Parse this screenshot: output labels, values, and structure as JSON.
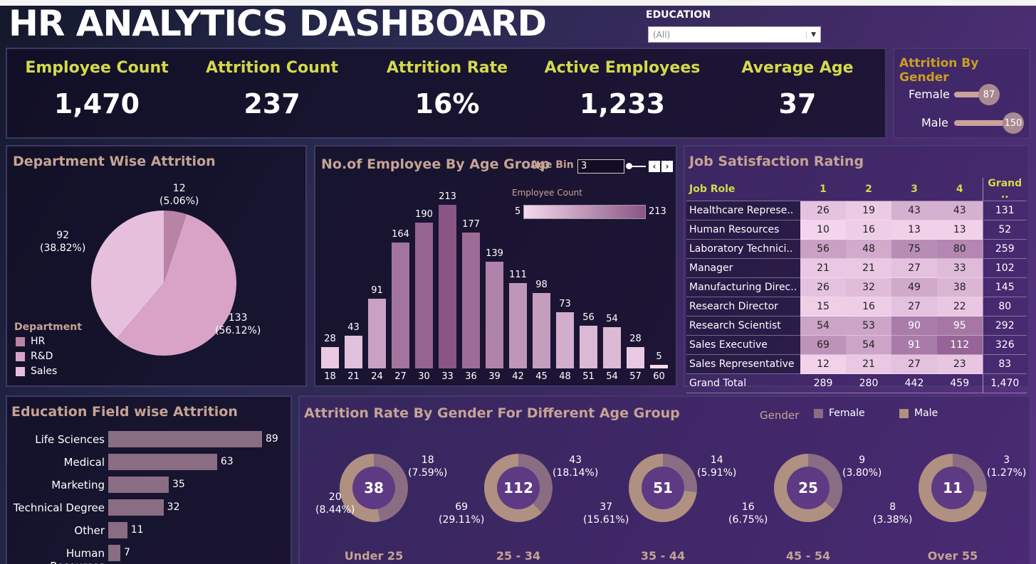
{
  "title": "HR ANALYTICS DASHBOARD",
  "filter": {
    "label": "EDUCATION",
    "value": "(All)"
  },
  "kpis": [
    {
      "label": "Employee Count",
      "value": "1,470"
    },
    {
      "label": "Attrition Count",
      "value": "237"
    },
    {
      "label": "Attrition Rate",
      "value": "16%"
    },
    {
      "label": "Active Employees",
      "value": "1,233"
    },
    {
      "label": "Average Age",
      "value": "37"
    }
  ],
  "gender_attrition": {
    "title": "Attrition By Gender",
    "items": [
      {
        "label": "Female",
        "value": "87",
        "fraction": 0.58
      },
      {
        "label": "Male",
        "value": "150",
        "fraction": 1.0
      }
    ]
  },
  "dept": {
    "title": "Department Wise Attrition",
    "legend_title": "Department",
    "legend": [
      {
        "label": "HR",
        "color": "#b983a6"
      },
      {
        "label": "R&D",
        "color": "#d8a3c7"
      },
      {
        "label": "Sales",
        "color": "#e6bfdc"
      }
    ],
    "labels": {
      "hr": "12\n(5.06%)",
      "rd": "133\n(56.12%)",
      "sales": "92\n(38.82%)"
    }
  },
  "age": {
    "title": "No.of Employee By Age Group",
    "bin_label": "Age Bin",
    "bin_value": "3",
    "legend_title": "Employee Count",
    "legend_min": "5",
    "legend_max": "213"
  },
  "job_sat": {
    "title": "Job Satisfaction Rating",
    "headers": [
      "Job Role",
      "1",
      "2",
      "3",
      "4",
      "Grand .."
    ],
    "rows": [
      {
        "role": "Healthcare Represe..",
        "v": [
          "26",
          "19",
          "43",
          "43"
        ],
        "total": "131"
      },
      {
        "role": "Human Resources",
        "v": [
          "10",
          "16",
          "13",
          "13"
        ],
        "total": "52"
      },
      {
        "role": "Laboratory Technici..",
        "v": [
          "56",
          "48",
          "75",
          "80"
        ],
        "total": "259"
      },
      {
        "role": "Manager",
        "v": [
          "21",
          "21",
          "27",
          "33"
        ],
        "total": "102"
      },
      {
        "role": "Manufacturing Direc..",
        "v": [
          "26",
          "32",
          "49",
          "38"
        ],
        "total": "145"
      },
      {
        "role": "Research Director",
        "v": [
          "15",
          "16",
          "27",
          "22"
        ],
        "total": "80"
      },
      {
        "role": "Research Scientist",
        "v": [
          "54",
          "53",
          "90",
          "95"
        ],
        "total": "292"
      },
      {
        "role": "Sales Executive",
        "v": [
          "69",
          "54",
          "91",
          "112"
        ],
        "total": "326"
      },
      {
        "role": "Sales Representative",
        "v": [
          "12",
          "21",
          "27",
          "23"
        ],
        "total": "83"
      }
    ],
    "grand": {
      "label": "Grand Total",
      "v": [
        "289",
        "280",
        "442",
        "459"
      ],
      "total": "1,470"
    }
  },
  "edu": {
    "title": "Education Field wise Attrition",
    "items": [
      {
        "label": "Life Sciences",
        "value": "89"
      },
      {
        "label": "Medical",
        "value": "63"
      },
      {
        "label": "Marketing",
        "value": "35"
      },
      {
        "label": "Technical Degree",
        "value": "32"
      },
      {
        "label": "Other",
        "value": "11"
      },
      {
        "label": "Human Resources",
        "value": "7"
      }
    ]
  },
  "gender_age": {
    "title": "Attrition Rate By Gender For Different Age Group",
    "legend_title": "Gender",
    "legend": [
      {
        "label": "Female",
        "color": "#8a6d82"
      },
      {
        "label": "Male",
        "color": "#b09080"
      }
    ],
    "groups": [
      {
        "label": "Under 25",
        "total": "38",
        "female": "18\n(7.59%)",
        "male": "20\n(8.44%)",
        "female_frac": 0.47
      },
      {
        "label": "25 - 34",
        "total": "112",
        "female": "43\n(18.14%)",
        "male": "69\n(29.11%)",
        "female_frac": 0.38
      },
      {
        "label": "35 - 44",
        "total": "51",
        "female": "14\n(5.91%)",
        "male": "37\n(15.61%)",
        "female_frac": 0.27
      },
      {
        "label": "45 - 54",
        "total": "25",
        "female": "9\n(3.80%)",
        "male": "16\n(6.75%)",
        "female_frac": 0.36
      },
      {
        "label": "Over 55",
        "total": "11",
        "female": "3\n(1.27%)",
        "male": "8\n(3.38%)",
        "female_frac": 0.27
      }
    ]
  },
  "chart_data": [
    {
      "type": "pie",
      "title": "Department Wise Attrition",
      "categories": [
        "HR",
        "R&D",
        "Sales"
      ],
      "values": [
        12,
        133,
        92
      ],
      "percentages": [
        5.06,
        56.12,
        38.82
      ]
    },
    {
      "type": "bar",
      "title": "No.of Employee By Age Group",
      "categories": [
        "18",
        "21",
        "24",
        "27",
        "30",
        "33",
        "36",
        "39",
        "42",
        "45",
        "48",
        "51",
        "54",
        "57",
        "60"
      ],
      "values": [
        28,
        43,
        91,
        164,
        190,
        213,
        177,
        139,
        111,
        98,
        73,
        56,
        54,
        28,
        5
      ]
    },
    {
      "type": "bar",
      "title": "Education Field wise Attrition",
      "categories": [
        "Life Sciences",
        "Medical",
        "Marketing",
        "Technical Degree",
        "Other",
        "Human Resources"
      ],
      "values": [
        89,
        63,
        35,
        32,
        11,
        7
      ]
    },
    {
      "type": "pie",
      "title": "Attrition Rate By Gender For Different Age Group",
      "series": [
        {
          "name": "Under 25",
          "values": [
            18,
            20
          ]
        },
        {
          "name": "25 - 34",
          "values": [
            43,
            69
          ]
        },
        {
          "name": "35 - 44",
          "values": [
            14,
            37
          ]
        },
        {
          "name": "45 - 54",
          "values": [
            9,
            16
          ]
        },
        {
          "name": "Over 55",
          "values": [
            3,
            8
          ]
        }
      ],
      "categories": [
        "Female",
        "Male"
      ]
    }
  ]
}
